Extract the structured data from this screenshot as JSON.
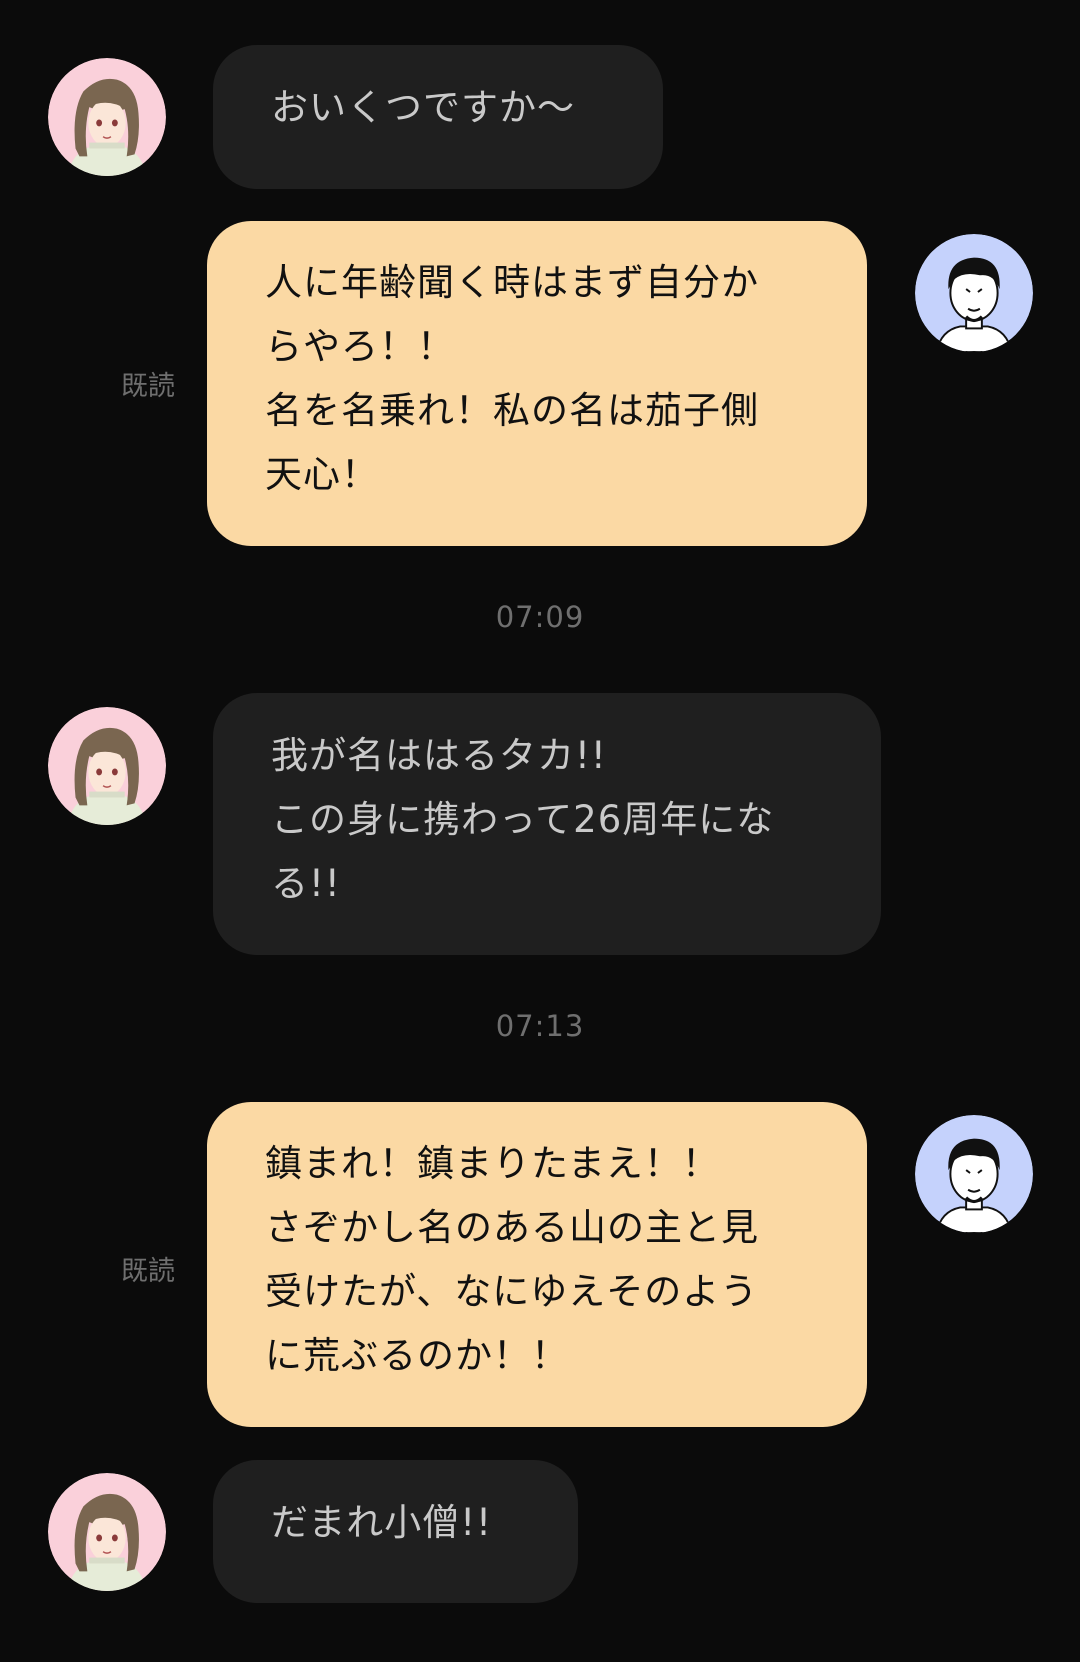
{
  "colors": {
    "background": "#0b0b0b",
    "incoming_bubble": "#1f1f1f",
    "outgoing_bubble": "#fbd9a4",
    "incoming_avatar_bg": "#fad0da",
    "outgoing_avatar_bg": "#c5d2fc"
  },
  "messages": [
    {
      "side": "incoming",
      "text": "おいくつですか〜",
      "avatar": "girl-avatar-icon"
    },
    {
      "side": "outgoing",
      "text": "人に年齢聞く時はまず自分か\nらやろ！！\n名を名乗れ！私の名は茄子側\n天心！",
      "read": "既読",
      "avatar": "man-avatar-icon"
    },
    {
      "side": "timestamp",
      "text": "07:09"
    },
    {
      "side": "incoming",
      "text": "我が名ははるタカ!!\nこの身に携わって26周年にな\nる!!",
      "avatar": "girl-avatar-icon"
    },
    {
      "side": "timestamp",
      "text": "07:13"
    },
    {
      "side": "outgoing",
      "text": "鎮まれ！鎮まりたまえ！！\nさぞかし名のある山の主と見\n受けたが、なにゆえそのよう\nに荒ぶるのか！！",
      "read": "既読",
      "avatar": "man-avatar-icon"
    },
    {
      "side": "incoming",
      "text": "だまれ小僧!!",
      "avatar": "girl-avatar-icon"
    }
  ]
}
